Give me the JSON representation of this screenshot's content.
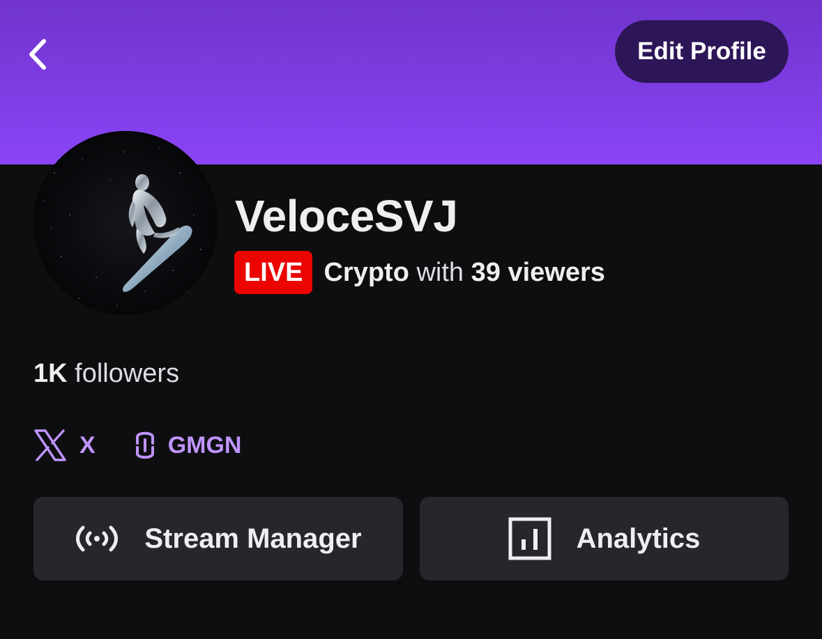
{
  "header": {
    "back_icon": "chevron-left-icon",
    "edit_label": "Edit Profile",
    "banner_colors": [
      "#7034cc",
      "#8a44f6"
    ]
  },
  "profile": {
    "username": "VeloceSVJ",
    "avatar_desc_icon": "avatar-image",
    "live_badge": "LIVE",
    "category": "Crypto",
    "with_text": "with",
    "viewers": "39 viewers",
    "followers_count": "1K",
    "followers_label": "followers"
  },
  "socials": [
    {
      "icon": "x-logo-icon",
      "label": "X"
    },
    {
      "icon": "link-icon",
      "label": "GMGN"
    }
  ],
  "actions": {
    "stream_manager": {
      "icon": "broadcast-icon",
      "label": "Stream Manager"
    },
    "analytics": {
      "icon": "bar-chart-icon",
      "label": "Analytics"
    }
  },
  "colors": {
    "accent": "#bf94ff",
    "live_red": "#eb0400",
    "background": "#0e0e10",
    "card": "#26262c",
    "edit_button": "#2d1657"
  }
}
